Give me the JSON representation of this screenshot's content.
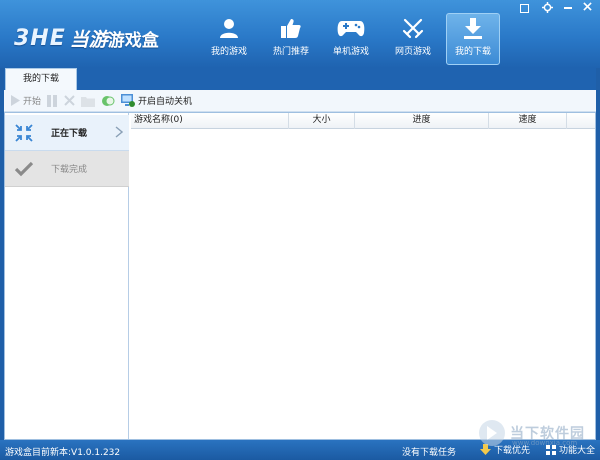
{
  "app": {
    "logo_mark": "3HE",
    "logo_brand": "当游",
    "logo_text": "游戏盒"
  },
  "nav": {
    "items": [
      {
        "label": "我的游戏",
        "icon": "user-icon"
      },
      {
        "label": "热门推荐",
        "icon": "thumbs-up-icon"
      },
      {
        "label": "单机游戏",
        "icon": "gamepad-icon"
      },
      {
        "label": "网页游戏",
        "icon": "crossed-swords-icon"
      },
      {
        "label": "我的下载",
        "icon": "download-icon"
      }
    ],
    "active_index": 4
  },
  "tabs": {
    "active": "我的下载"
  },
  "toolbar": {
    "start": "开始",
    "auto_shutdown": "开启自动关机"
  },
  "sidebar": {
    "downloading": "正在下载",
    "completed": "下载完成"
  },
  "table": {
    "columns": [
      "游戏名称(0)",
      "大小",
      "进度",
      "速度"
    ],
    "rows": []
  },
  "status": {
    "version": "游戏盒目前新本:V1.0.1.232",
    "no_tasks": "没有下载任务",
    "priority": "下载优先",
    "features": "功能大全"
  },
  "watermark": {
    "text": "当下软件园",
    "url": "www.downxia.com"
  },
  "colors": {
    "header_blue": "#2a79c8",
    "status_blue": "#1b5aa2",
    "sidebar_selected": "#e9f2fb"
  }
}
